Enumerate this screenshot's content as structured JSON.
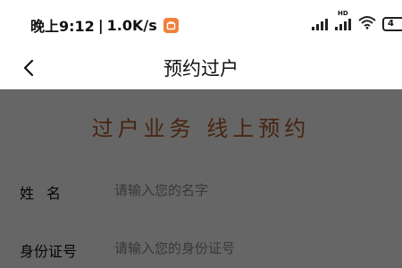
{
  "status_bar": {
    "time": "晚上9:12",
    "separator": "|",
    "net_speed": "1.0K/s",
    "hd_label": "HD",
    "battery_text": "4",
    "notification_color": "#f0803c"
  },
  "nav": {
    "title": "预约过户",
    "back_icon": "chevron-left-icon"
  },
  "content": {
    "banner_title": "过户业务  线上预约",
    "banner_color": "#b45a2a",
    "form": {
      "name_label": "姓名",
      "name_value": "",
      "name_placeholder": "请输入您的名字",
      "id_label": "身份证号",
      "id_value": "",
      "id_placeholder": "请输入您的身份证号"
    }
  },
  "overlay_color": "#000000"
}
